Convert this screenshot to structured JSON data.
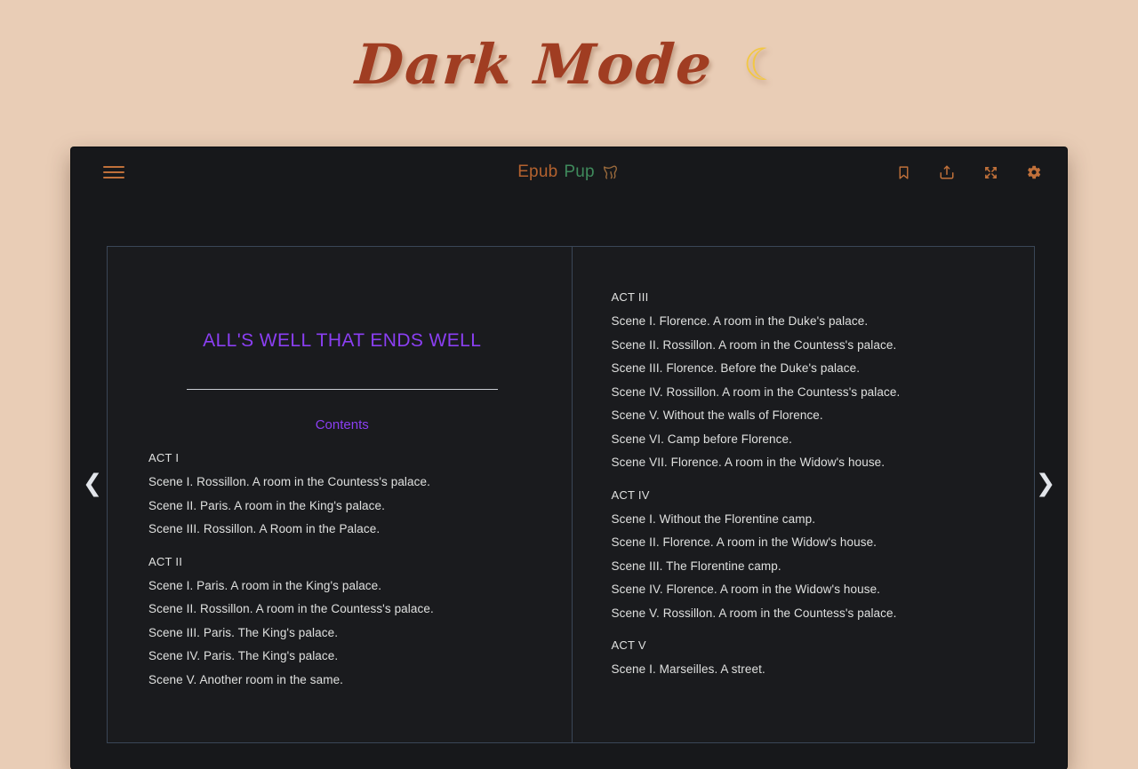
{
  "page": {
    "heading": "Dark Mode",
    "heading_icon": "crescent-moon",
    "heading_glyph": "☾",
    "background_color": "#e9cdb6",
    "heading_color": "#a03d22"
  },
  "app": {
    "brand": {
      "name_part_one": "Epub",
      "name_part_two": "Pup",
      "logo_icon": "dog-outline-icon",
      "color_part_one": "#b4622f",
      "color_part_two": "#3f8a5c"
    },
    "menu_button": {
      "icon": "hamburger-menu-icon",
      "label": "Menu",
      "color": "#c0703a"
    },
    "toolbar_actions": [
      {
        "icon": "bookmark-icon",
        "label": "Bookmark"
      },
      {
        "icon": "upload-file-icon",
        "label": "Load book"
      },
      {
        "icon": "fullscreen-icon",
        "label": "Fullscreen"
      },
      {
        "icon": "gear-icon",
        "label": "Settings"
      }
    ],
    "navigation": {
      "previous": {
        "icon": "chevron-left-icon",
        "glyph": "❮",
        "label": "Previous page"
      },
      "next": {
        "icon": "chevron-right-icon",
        "glyph": "❯",
        "label": "Next page"
      }
    },
    "theme": {
      "panel_background": "#1a1b1e",
      "window_background": "#17181b",
      "border": "#3a4657"
    }
  },
  "book": {
    "title": "ALL'S WELL THAT ENDS WELL",
    "contents_heading": "Contents",
    "accent_color": "#8b3ff3",
    "text_color": "#dfe0df",
    "left_page": [
      {
        "act": "ACT I",
        "scenes": [
          "Scene I. Rossillon. A room in the Countess's palace.",
          "Scene II. Paris. A room in the King's palace.",
          "Scene III. Rossillon. A Room in the Palace."
        ]
      },
      {
        "act": "ACT II",
        "scenes": [
          "Scene I. Paris. A room in the King's palace.",
          "Scene II. Rossillon. A room in the Countess's palace.",
          "Scene III. Paris. The King's palace.",
          "Scene IV. Paris. The King's palace.",
          "Scene V. Another room in the same."
        ]
      }
    ],
    "right_page": [
      {
        "act": "ACT III",
        "scenes": [
          "Scene I. Florence. A room in the Duke's palace.",
          "Scene II. Rossillon. A room in the Countess's palace.",
          "Scene III. Florence. Before the Duke's palace.",
          "Scene IV. Rossillon. A room in the Countess's palace.",
          "Scene V. Without the walls of Florence.",
          "Scene VI. Camp before Florence.",
          "Scene VII. Florence. A room in the Widow's house."
        ]
      },
      {
        "act": "ACT IV",
        "scenes": [
          "Scene I. Without the Florentine camp.",
          "Scene II. Florence. A room in the Widow's house.",
          "Scene III. The Florentine camp.",
          "Scene IV. Florence. A room in the Widow's house.",
          "Scene V. Rossillon. A room in the Countess's palace."
        ]
      },
      {
        "act": "ACT V",
        "scenes": [
          "Scene I. Marseilles. A street."
        ]
      }
    ]
  }
}
